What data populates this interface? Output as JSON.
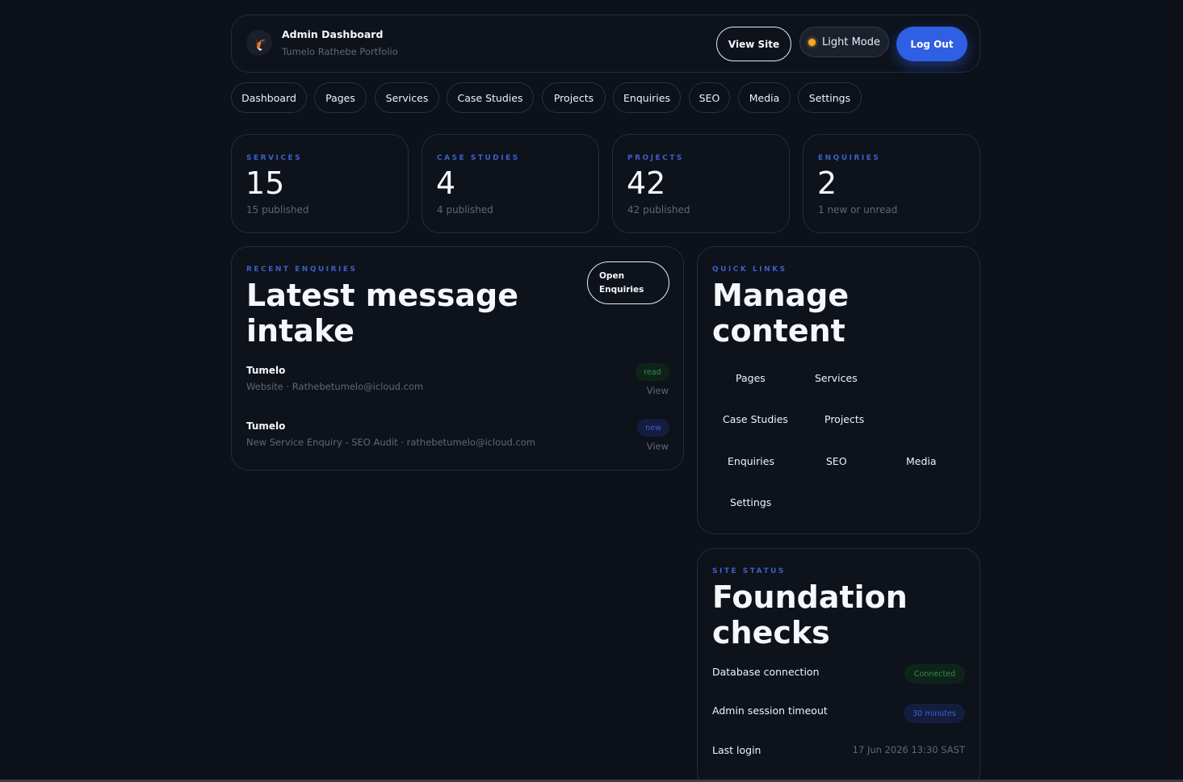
{
  "header": {
    "title": "Admin Dashboard",
    "subtitle": "Tumelo Rathebe Portfolio",
    "view_site": "View Site",
    "mode_toggle": "Light Mode",
    "logout": "Log Out"
  },
  "nav": [
    "Dashboard",
    "Pages",
    "Services",
    "Case Studies",
    "Projects",
    "Enquiries",
    "SEO",
    "Media",
    "Settings"
  ],
  "stats": [
    {
      "label": "SERVICES",
      "value": "15",
      "note": "15 published"
    },
    {
      "label": "CASE STUDIES",
      "value": "4",
      "note": "4 published"
    },
    {
      "label": "PROJECTS",
      "value": "42",
      "note": "42 published"
    },
    {
      "label": "ENQUIRIES",
      "value": "2",
      "note": "1 new or unread"
    }
  ],
  "enquiries": {
    "eyebrow": "RECENT ENQUIRIES",
    "title_line1": "Latest message",
    "title_line2": "intake",
    "open_line1": "Open",
    "open_line2": "Enquiries",
    "items": [
      {
        "name": "Tumelo",
        "meta": "Website · Rathebetumelo@icloud.com",
        "status": "read",
        "action": "View"
      },
      {
        "name": "Tumelo",
        "meta": "New Service Enquiry - SEO Audit · rathebetumelo@icloud.com",
        "status": "new",
        "action": "View"
      }
    ]
  },
  "quick_links": {
    "eyebrow": "QUICK LINKS",
    "title_line1": "Manage",
    "title_line2": "content",
    "links": [
      "Pages",
      "Services",
      "Case Studies",
      "Projects",
      "Enquiries",
      "SEO",
      "Media",
      "Settings"
    ]
  },
  "site_status": {
    "eyebrow": "SITE STATUS",
    "title_line1": "Foundation",
    "title_line2": "checks",
    "rows": [
      {
        "label": "Database connection",
        "value": "Connected"
      },
      {
        "label": "Admin session timeout",
        "value": "30 minutes"
      },
      {
        "label": "Last login",
        "value": "17 Jun 2026 13:30 SAST"
      }
    ]
  },
  "colors": {
    "accent": "#2f5fe3",
    "background": "#0c111a",
    "success": "#2f8a4f",
    "mode_dot": "#f5a524"
  }
}
